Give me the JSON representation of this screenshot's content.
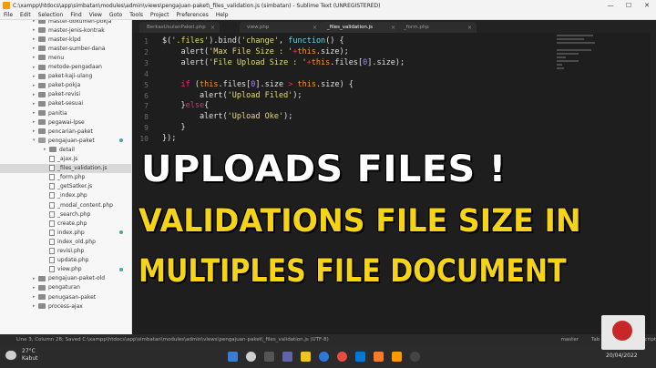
{
  "window": {
    "title": "C:\\xampp\\htdocs\\app\\simbatan\\modules\\admin\\views\\pengajuan-paket\\_files_validation.js (simbatan) - Sublime Text (UNREGISTERED)"
  },
  "menu": [
    "File",
    "Edit",
    "Selection",
    "Find",
    "View",
    "Goto",
    "Tools",
    "Project",
    "Preferences",
    "Help"
  ],
  "sidebar": {
    "items": [
      {
        "label": "master-dokumen-pokja",
        "type": "folder"
      },
      {
        "label": "master-jenis-kontrak",
        "type": "folder"
      },
      {
        "label": "master-klpd",
        "type": "folder"
      },
      {
        "label": "master-sumber-dana",
        "type": "folder"
      },
      {
        "label": "menu",
        "type": "folder"
      },
      {
        "label": "metode-pengadaan",
        "type": "folder"
      },
      {
        "label": "paket-kaji-ulang",
        "type": "folder"
      },
      {
        "label": "paket-pokja",
        "type": "folder"
      },
      {
        "label": "paket-revisi",
        "type": "folder"
      },
      {
        "label": "paket-sesuai",
        "type": "folder"
      },
      {
        "label": "panitia",
        "type": "folder"
      },
      {
        "label": "pegawai-lpse",
        "type": "folder"
      },
      {
        "label": "pencarian-paket",
        "type": "folder"
      },
      {
        "label": "pengajuan-paket",
        "type": "folder-open"
      },
      {
        "label": "detail",
        "type": "folder"
      },
      {
        "label": "_ajax.js",
        "type": "file"
      },
      {
        "label": "_files_validation.js",
        "type": "file"
      },
      {
        "label": "_form.php",
        "type": "file"
      },
      {
        "label": "_getSatker.js",
        "type": "file"
      },
      {
        "label": "_index.php",
        "type": "file"
      },
      {
        "label": "_modal_content.php",
        "type": "file"
      },
      {
        "label": "_search.php",
        "type": "file"
      },
      {
        "label": "create.php",
        "type": "file"
      },
      {
        "label": "index.php",
        "type": "file"
      },
      {
        "label": "index_old.php",
        "type": "file"
      },
      {
        "label": "revisi.php",
        "type": "file"
      },
      {
        "label": "update.php",
        "type": "file"
      },
      {
        "label": "view.php",
        "type": "file"
      },
      {
        "label": "pengajuan-paket-old",
        "type": "folder"
      },
      {
        "label": "pengaturan",
        "type": "folder"
      },
      {
        "label": "penugasan-paket",
        "type": "folder"
      },
      {
        "label": "process-ajax",
        "type": "folder"
      }
    ]
  },
  "tabs": [
    {
      "label": "BerkasUsulanPaket.php"
    },
    {
      "label": "view.php"
    },
    {
      "label": "_files_validation.js"
    },
    {
      "label": "_form.php"
    }
  ],
  "code": {
    "lines": [
      {
        "n": "1",
        "parts": [
          [
            "$",
            "#e0e0e0"
          ],
          [
            "(",
            "#e0e0e0"
          ],
          [
            "'.files'",
            "#e6db74"
          ],
          [
            ").bind(",
            "#e0e0e0"
          ],
          [
            "'change'",
            "#e6db74"
          ],
          [
            ", ",
            "#e0e0e0"
          ],
          [
            "function",
            "#66d9ef"
          ],
          [
            "() {",
            "#e0e0e0"
          ]
        ]
      },
      {
        "n": "2",
        "parts": [
          [
            "    alert(",
            "#e0e0e0"
          ],
          [
            "'Max File Size : '",
            "#e6db74"
          ],
          [
            "+",
            "#f92672"
          ],
          [
            "this",
            "#fd971f"
          ],
          [
            ".size);",
            "#e0e0e0"
          ]
        ]
      },
      {
        "n": "3",
        "parts": [
          [
            "    alert(",
            "#e0e0e0"
          ],
          [
            "'File Upload Size : '",
            "#e6db74"
          ],
          [
            "+",
            "#f92672"
          ],
          [
            "this",
            "#fd971f"
          ],
          [
            ".files[",
            "#e0e0e0"
          ],
          [
            "0",
            "#ae81ff"
          ],
          [
            "].size);",
            "#e0e0e0"
          ]
        ]
      },
      {
        "n": "4",
        "parts": []
      },
      {
        "n": "5",
        "parts": [
          [
            "    ",
            "#e0e0e0"
          ],
          [
            "if",
            "#f92672"
          ],
          [
            " (",
            "#e0e0e0"
          ],
          [
            "this",
            "#fd971f"
          ],
          [
            ".files[",
            "#e0e0e0"
          ],
          [
            "0",
            "#ae81ff"
          ],
          [
            "].size ",
            "#e0e0e0"
          ],
          [
            ">",
            "#f92672"
          ],
          [
            " ",
            "#e0e0e0"
          ],
          [
            "this",
            "#fd971f"
          ],
          [
            ".size) {",
            "#e0e0e0"
          ]
        ]
      },
      {
        "n": "6",
        "parts": [
          [
            "        alert(",
            "#e0e0e0"
          ],
          [
            "'Upload Filed'",
            "#e6db74"
          ],
          [
            ");",
            "#e0e0e0"
          ]
        ]
      },
      {
        "n": "7",
        "parts": [
          [
            "    }",
            "#e0e0e0"
          ],
          [
            "else",
            "#f92672"
          ],
          [
            "{",
            "#e0e0e0"
          ]
        ]
      },
      {
        "n": "8",
        "parts": [
          [
            "        alert(",
            "#e0e0e0"
          ],
          [
            "'Upload Oke'",
            "#e6db74"
          ],
          [
            ");",
            "#e0e0e0"
          ]
        ]
      },
      {
        "n": "9",
        "parts": [
          [
            "    }",
            "#e0e0e0"
          ]
        ]
      },
      {
        "n": "10",
        "parts": [
          [
            "});",
            "#e0e0e0"
          ]
        ]
      }
    ]
  },
  "overlay": {
    "line1": "UPLOADS FILES !",
    "line2": "VALIDATIONS FILE SIZE IN",
    "line3": "MULTIPLES FILE DOCUMENT"
  },
  "statusbar": {
    "left": "Line 3, Column 28; Saved C:\\xampp\\htdocs\\app\\simbatan\\modules\\admin\\views\\pengajuan-paket\\_files_validation.js (UTF-8)",
    "branch": "master",
    "tabsize": "Tab Size: 4",
    "syntax": "JavaScript"
  },
  "taskbar": {
    "temp": "27°C",
    "weather": "Kabut",
    "date": "20/04/2022"
  },
  "colors": {
    "overlay_white": "#ffffff",
    "overlay_yellow": "#f5d418",
    "editor_bg": "#1e1e1e",
    "sidebar_dot": "#48a8a0"
  }
}
